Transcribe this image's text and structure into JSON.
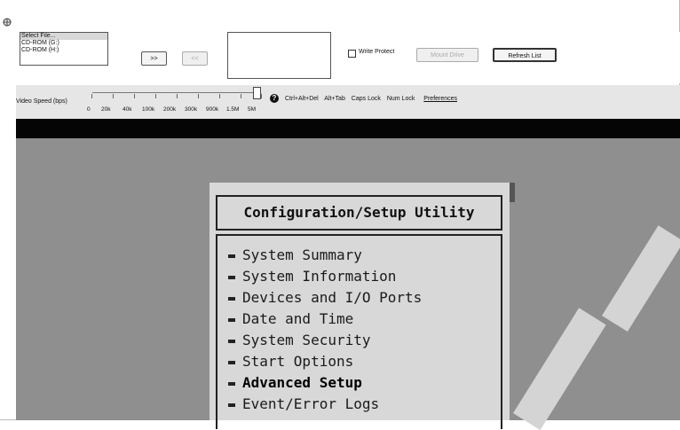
{
  "media": {
    "file_list": [
      "Select File...",
      "CD-ROM (G:)",
      "CD-ROM (H:)"
    ],
    "forward_button": ">>",
    "back_button": "<<",
    "write_protect_label": "Write Protect",
    "mount_drive_button": "Mount Drive",
    "refresh_list_button": "Refresh List"
  },
  "toolbar": {
    "video_speed_label": "Video Speed (bps)",
    "speed_ticks": [
      "0",
      "20k",
      "40k",
      "100k",
      "200k",
      "300k",
      "900k",
      "1.5M",
      "5M"
    ],
    "help_icon": "?",
    "ctrl_alt_del": "Ctrl+Alt+Del",
    "alt_tab": "Alt+Tab",
    "caps_lock": "Caps Lock",
    "num_lock": "Num Lock",
    "preferences": "Preferences"
  },
  "bios": {
    "title": "Configuration/Setup Utility",
    "items": [
      "System Summary",
      "System Information",
      "Devices and I/O Ports",
      "Date and Time",
      "System Security",
      "Start Options",
      "Advanced Setup",
      "Event/Error Logs"
    ],
    "selected_item": "Advanced Setup"
  }
}
